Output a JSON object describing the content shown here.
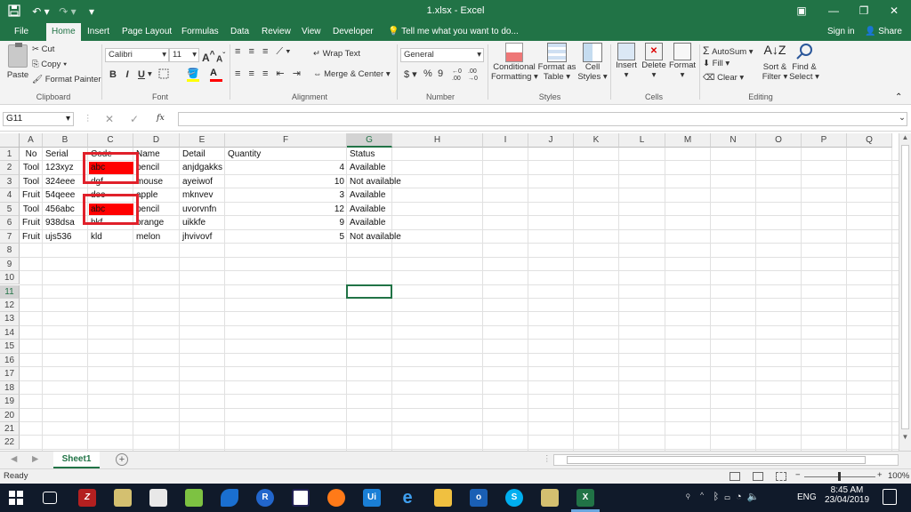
{
  "window": {
    "title": "1.xlsx - Excel",
    "qa_save_icon": "save-icon",
    "qa_undo_icon": "undo-icon",
    "qa_redo_icon": "redo-icon",
    "sign_in": "Sign in",
    "share": "Share"
  },
  "menu": {
    "tabs": [
      "File",
      "Home",
      "Insert",
      "Page Layout",
      "Formulas",
      "Data",
      "Review",
      "View",
      "Developer"
    ],
    "active": "Home",
    "tell_me": "Tell me what you want to do..."
  },
  "ribbon": {
    "clipboard": {
      "paste": "Paste",
      "cut": "Cut",
      "copy": "Copy",
      "format_painter": "Format Painter",
      "label": "Clipboard"
    },
    "font": {
      "name": "Calibri",
      "size": "11",
      "bold": "B",
      "italic": "I",
      "underline": "U",
      "grow": "A",
      "shrink": "A",
      "label": "Font"
    },
    "alignment": {
      "wrap": "Wrap Text",
      "merge": "Merge & Center",
      "label": "Alignment"
    },
    "number": {
      "format": "General",
      "currency": "$",
      "percent": "%",
      "comma": "9",
      "inc": ".00",
      "label": "Number"
    },
    "styles": {
      "conditional": "Conditional",
      "conditional2": "Formatting",
      "format_as": "Format as",
      "format_as2": "Table",
      "cell_styles": "Cell",
      "cell_styles2": "Styles",
      "label": "Styles"
    },
    "cells": {
      "insert": "Insert",
      "delete": "Delete",
      "format": "Format",
      "label": "Cells"
    },
    "editing": {
      "autosum": "AutoSum",
      "fill": "Fill",
      "clear": "Clear",
      "sort": "Sort &",
      "sort2": "Filter",
      "find": "Find &",
      "find2": "Select",
      "label": "Editing"
    }
  },
  "formula_bar": {
    "name_box": "G11",
    "fx": "fx",
    "value": ""
  },
  "grid": {
    "columns": [
      "A",
      "B",
      "C",
      "D",
      "E",
      "F",
      "G",
      "H",
      "I",
      "J",
      "K",
      "L",
      "M",
      "N",
      "O",
      "P",
      "Q"
    ],
    "rows": [
      "1",
      "2",
      "3",
      "4",
      "5",
      "6",
      "7",
      "8",
      "9",
      "10",
      "11",
      "12",
      "13",
      "14",
      "15",
      "16",
      "17",
      "18",
      "19",
      "20",
      "21",
      "22"
    ],
    "selected_cell": "G11",
    "data": [
      [
        "No",
        "Serial",
        "Code",
        "Name",
        "Detail",
        "Quantity",
        "Status"
      ],
      [
        "Tool",
        "123xyz",
        "abc",
        "pencil",
        "anjdgakks",
        "4",
        "Available"
      ],
      [
        "Tool",
        "324eee",
        "dgf",
        "mouse",
        "ayeiwof",
        "10",
        "Not available"
      ],
      [
        "Fruit",
        "54qeee",
        "dec",
        "apple",
        "mknvev",
        "3",
        "Available"
      ],
      [
        "Tool",
        "456abc",
        "abc",
        "pencil",
        "uvorvnfn",
        "12",
        "Available"
      ],
      [
        "Fruit",
        "938dsa",
        "hkf",
        "orange",
        "uikkfe",
        "9",
        "Available"
      ],
      [
        "Fruit",
        "ujs536",
        "kld",
        "melon",
        "jhvivovf",
        "5",
        "Not available"
      ]
    ],
    "highlight_color": "#ff0000",
    "highlight_border": "#e0202a"
  },
  "sheets": {
    "tabs": [
      "Sheet1"
    ],
    "active": "Sheet1"
  },
  "status": {
    "ready": "Ready",
    "zoom": "100%"
  },
  "taskbar": {
    "time": "8:45 AM",
    "date": "23/04/2019",
    "lang": "ENG",
    "accent": "#217346"
  }
}
